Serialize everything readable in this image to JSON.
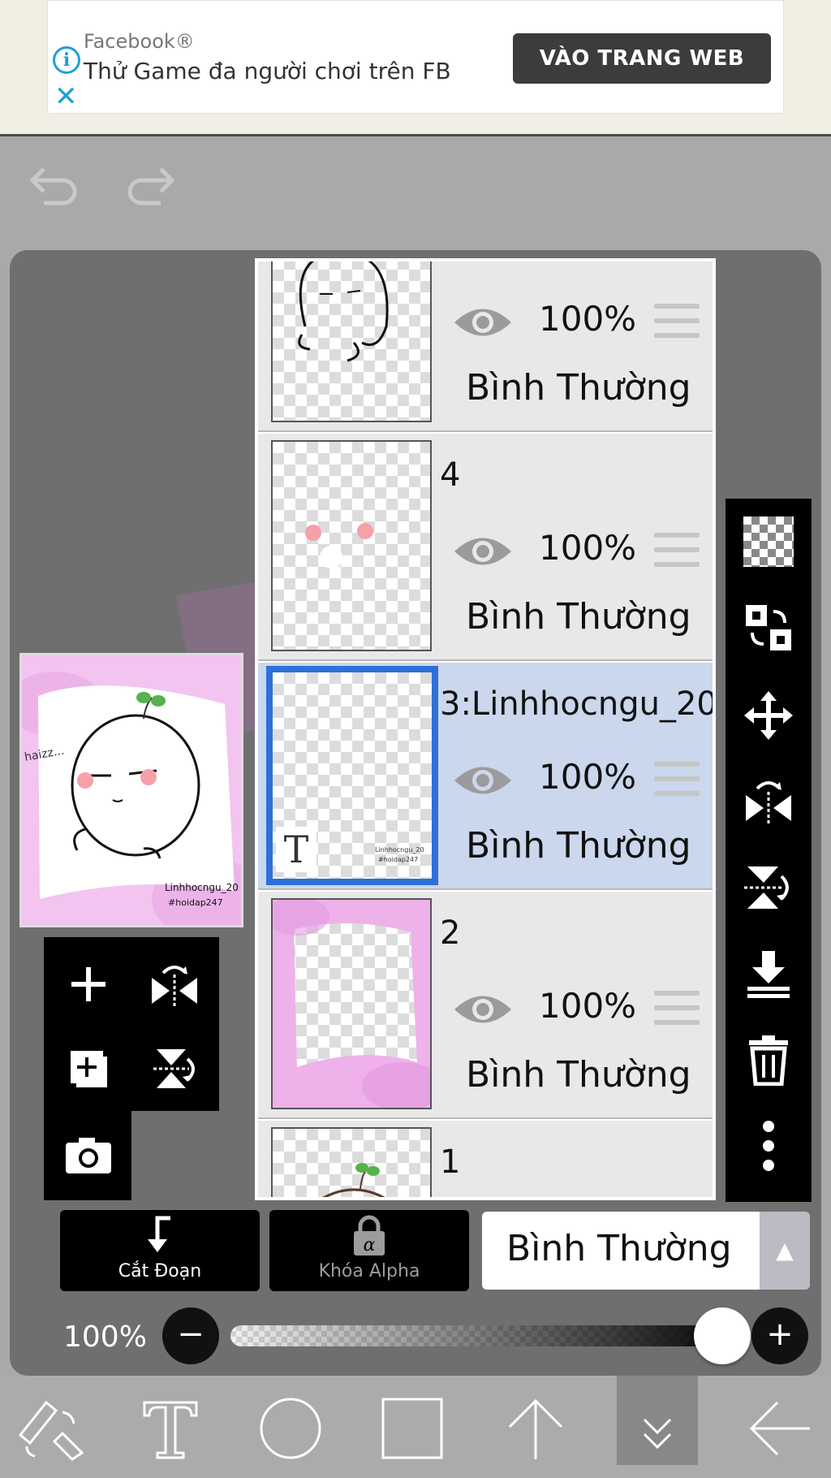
{
  "ad": {
    "brand": "Facebook®",
    "headline": "Thử Game đa người chơi trên FB",
    "cta": "VÀO TRANG WEB"
  },
  "layers": [
    {
      "name": "",
      "opacity": "100%",
      "mode": "Bình Thường",
      "selected": false
    },
    {
      "name": "4",
      "opacity": "100%",
      "mode": "Bình Thường",
      "selected": false
    },
    {
      "name": "3:Linhhocngu_20",
      "opacity": "100%",
      "mode": "Bình Thường",
      "selected": true
    },
    {
      "name": "2",
      "opacity": "100%",
      "mode": "Bình Thường",
      "selected": false
    },
    {
      "name": "1",
      "opacity": "",
      "mode": "",
      "selected": false
    }
  ],
  "preview": {
    "caption_1": "Linhhocngu_20",
    "caption_2": "#hoidap247",
    "doodle": "haizz..."
  },
  "thumb_text": {
    "t_glyph": "T",
    "line1": "Linhhocngu_20",
    "line2": "#hoidap247"
  },
  "bottom": {
    "clip_label": "Cắt Đoạn",
    "alpha_label": "Khóa Alpha",
    "blend_mode": "Bình Thường",
    "opacity_label": "100%",
    "opacity_value": 1.0
  },
  "colors": {
    "selected_layer": "#cad7ec",
    "selection_border": "#2f6fd8",
    "ad_accent": "#1ea0d8"
  },
  "icons": {
    "top": [
      "undo-icon",
      "redo-icon"
    ],
    "right_toolbar": [
      "transparency-icon",
      "swap-layers-icon",
      "move-icon",
      "flip-horizontal-icon",
      "flip-vertical-icon",
      "merge-down-icon",
      "trash-icon",
      "more-icon"
    ],
    "layer_tools": [
      "add-layer-icon",
      "flip-layer-icon",
      "duplicate-layer-icon",
      "rotate-layer-icon",
      "camera-icon"
    ],
    "bottom_bar": [
      "transform-icon",
      "text-tool-icon",
      "ellipse-tool-icon",
      "rectangle-tool-icon",
      "arrow-up-icon",
      "collapse-icon",
      "back-icon"
    ]
  }
}
